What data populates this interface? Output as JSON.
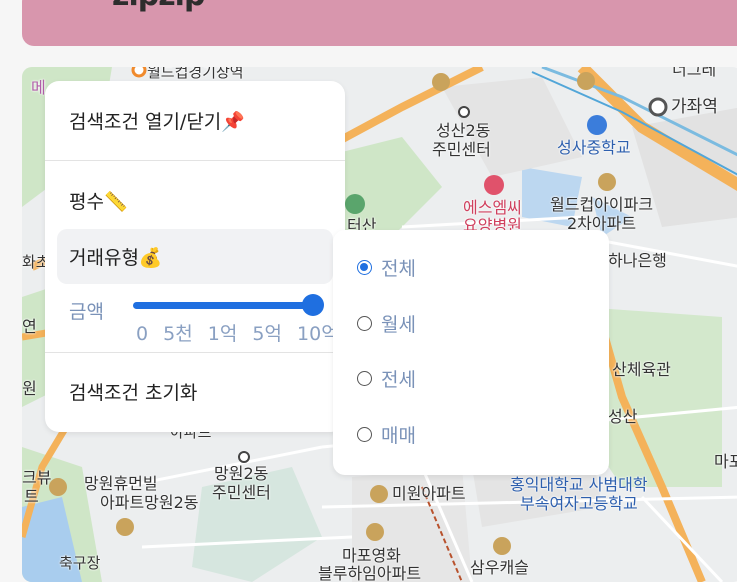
{
  "header": {
    "logo": "zipzip",
    "color": "#d896ad"
  },
  "filter_panel": {
    "title": "검색조건 열기/닫기📌",
    "area_label": "평수📏",
    "deal_type_label": "거래유형💰",
    "amount_label": "금액",
    "amount_ticks": [
      "0",
      "5천",
      "1억",
      "5억",
      "10억"
    ],
    "amount_slider_fraction": 1.0,
    "reset_label": "검색조건 초기화",
    "accent_color": "#1f6fe0"
  },
  "deal_type_options": {
    "selected": "전체",
    "items": [
      {
        "label": "전체",
        "checked": true
      },
      {
        "label": "월세",
        "checked": false
      },
      {
        "label": "전세",
        "checked": false
      },
      {
        "label": "매매",
        "checked": false
      }
    ]
  },
  "map_labels": {
    "l1": "월드컵경기장역",
    "l2": "가좌역",
    "l3": "성산2동",
    "l4": "주민센터",
    "l5": "성사중학교",
    "l6": "에스엠씨",
    "l7": "요양병원",
    "l8": "월드컵아이파크",
    "l9": "2차아파트",
    "l10": "하나은행",
    "l11": "산체육관",
    "l12": "성산",
    "l13": "망원2동",
    "l14": "주민센터",
    "l15": "망원휴먼빌",
    "l16": "아파트망원2동",
    "l17": "미원아파트",
    "l18": "홍익대학교 사범대학",
    "l19": "부속여자고등학교",
    "l20": "마포영화",
    "l21": "블루하임아파트",
    "l22": "삼우캐슬",
    "l23": "축구장",
    "l24": "아파트",
    "l25": "마포",
    "l26": "트",
    "l27": "원",
    "l28": "화초",
    "l29": "메",
    "l30": "연",
    "l31": "너그레",
    "l32": "터산",
    "l33": "크뷰"
  }
}
